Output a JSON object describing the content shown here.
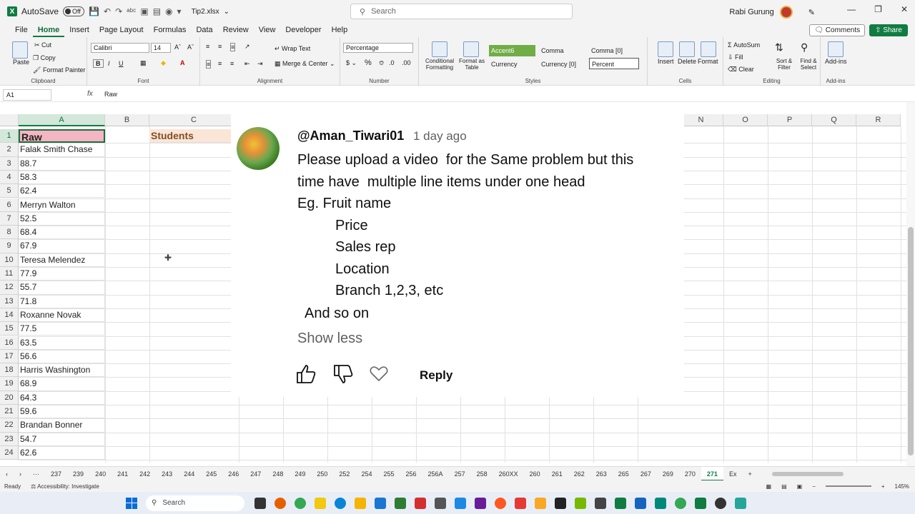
{
  "titlebar": {
    "autosave_label": "AutoSave",
    "autosave_state": "Off",
    "filename": "Tip2.xlsx",
    "search_placeholder": "Search",
    "user_name": "Rabi Gurung"
  },
  "menu": {
    "tabs": [
      "File",
      "Home",
      "Insert",
      "Page Layout",
      "Formulas",
      "Data",
      "Review",
      "View",
      "Developer",
      "Help"
    ],
    "active": "Home",
    "comments_label": "Comments",
    "share_label": "Share"
  },
  "ribbon": {
    "clipboard": {
      "paste": "Paste",
      "cut": "Cut",
      "copy": "Copy",
      "format_painter": "Format Painter",
      "label": "Clipboard"
    },
    "font": {
      "name": "Calibri",
      "size": "14",
      "label": "Font"
    },
    "alignment": {
      "wrap": "Wrap Text",
      "merge": "Merge & Center",
      "label": "Alignment"
    },
    "number": {
      "format": "Percentage",
      "label": "Number"
    },
    "styles": {
      "conditional": "Conditional Formatting",
      "format_table": "Format as Table",
      "accent": "Accent6",
      "comma": "Comma",
      "comma0": "Comma [0]",
      "currency": "Currency",
      "currency0": "Currency [0]",
      "percent": "Percent",
      "label": "Styles"
    },
    "cells": {
      "insert": "Insert",
      "delete": "Delete",
      "format": "Format",
      "label": "Cells"
    },
    "editing": {
      "autosum": "AutoSum",
      "fill": "Fill",
      "clear": "Clear",
      "sort": "Sort & Filter",
      "find": "Find & Select",
      "label": "Editing"
    },
    "addins": {
      "addins": "Add-ins",
      "label": "Add-ins"
    }
  },
  "formula_bar": {
    "name_box": "A1",
    "fx": "fx",
    "content": "Raw"
  },
  "columns": [
    "A",
    "B",
    "C",
    "N",
    "O",
    "P",
    "Q",
    "R"
  ],
  "rows": [
    {
      "n": "1",
      "a": "Raw",
      "c": "Students"
    },
    {
      "n": "2",
      "a": "Falak Smith Chase"
    },
    {
      "n": "3",
      "a": "88.7"
    },
    {
      "n": "4",
      "a": "58.3"
    },
    {
      "n": "5",
      "a": "62.4"
    },
    {
      "n": "6",
      "a": "Merryn Walton"
    },
    {
      "n": "7",
      "a": "52.5"
    },
    {
      "n": "8",
      "a": "68.4"
    },
    {
      "n": "9",
      "a": "67.9"
    },
    {
      "n": "10",
      "a": "Teresa Melendez"
    },
    {
      "n": "11",
      "a": "77.9"
    },
    {
      "n": "12",
      "a": "55.7"
    },
    {
      "n": "13",
      "a": "71.8"
    },
    {
      "n": "14",
      "a": "Roxanne Novak"
    },
    {
      "n": "15",
      "a": "77.5"
    },
    {
      "n": "16",
      "a": "63.5"
    },
    {
      "n": "17",
      "a": "56.6"
    },
    {
      "n": "18",
      "a": "Harris Washington"
    },
    {
      "n": "19",
      "a": "68.9"
    },
    {
      "n": "20",
      "a": "64.3"
    },
    {
      "n": "21",
      "a": "59.6"
    },
    {
      "n": "22",
      "a": "Brandan Bonner"
    },
    {
      "n": "23",
      "a": "54.7"
    },
    {
      "n": "24",
      "a": "62.6"
    }
  ],
  "comment": {
    "user": "@Aman_Tiwari01",
    "time": "1 day ago",
    "lines": [
      "Please upload a video  for the Same problem but this",
      "time have  multiple line items under one head",
      "Eg. Fruit name",
      "Price",
      "Sales rep",
      "Location",
      "Branch 1,2,3, etc",
      "And so on"
    ],
    "show_less": "Show less",
    "reply": "Reply"
  },
  "sheet_tabs": [
    "237",
    "239",
    "240",
    "241",
    "242",
    "243",
    "244",
    "245",
    "246",
    "247",
    "248",
    "249",
    "250",
    "252",
    "254",
    "255",
    "256",
    "256A",
    "257",
    "258",
    "260XX",
    "260",
    "261",
    "262",
    "263",
    "265",
    "267",
    "269",
    "270",
    "271",
    "Ex"
  ],
  "active_sheet": "271",
  "status": {
    "ready": "Ready",
    "accessibility": "Accessibility: Investigate",
    "zoom": "145%"
  },
  "taskbar": {
    "search": "Search"
  }
}
